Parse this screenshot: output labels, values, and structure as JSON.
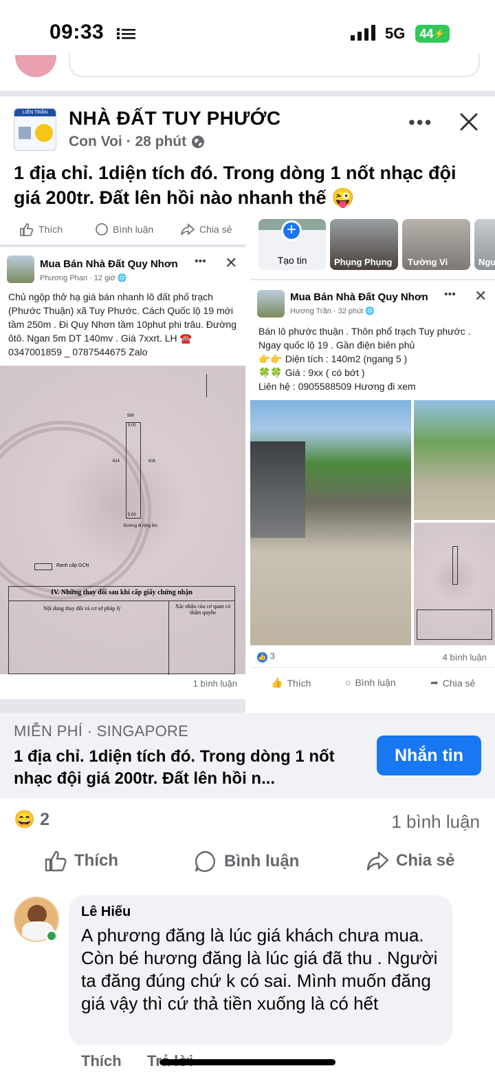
{
  "status_bar": {
    "time": "09:33",
    "network": "5G",
    "battery": "44"
  },
  "post": {
    "group_name": "NHÀ ĐẤT TUY PHƯỚC",
    "author": "Con Voi",
    "sep": "·",
    "time": "28 phút",
    "text": "1 địa chỉ. 1diện tích đó. Trong dòng 1 nốt nhạc đội giá 200tr. Đất lên hồi nào nhanh thế 😜",
    "group_logo_text": "LIÊN TRẦN"
  },
  "left_screenshot": {
    "actions": [
      "Thích",
      "Bình luận",
      "Chia sẻ"
    ],
    "group": "Mua Bán Nhà Đất Quy Nhơn",
    "author": "Phương Phan",
    "time": "12 giờ",
    "text": "Chủ ngộp thở hạ giá bán nhanh lô đất phố trạch (Phước Thuận) xã Tuy Phước. Cách Quốc lộ 19 mới tầm 250m . Đi Quy Nhơn tầm 10phut phi trâu. Đường ôtô. Ngan 5m DT 140mv . Giá 7xxrt. LH ☎️ 0347001859 _ 0787544675 Zalo",
    "cert_heading": "IV. Những thay đổi sau khi cấp giấy chứng nhận",
    "cert_col1": "Nội dung thay đổi và cơ sở pháp lý",
    "cert_col2": "Xác nhận của cơ quan có thẩm quyền",
    "cert_note": "Ranh cấp GCN",
    "plot_label": "Đường đi rộng 5m",
    "plot_top": "5.00",
    "plot_bottom": "5.00",
    "plot_left": "614",
    "plot_right": "616",
    "plot_num": "580",
    "comments": "1 bình luận"
  },
  "stories": {
    "create_label": "Tạo tin",
    "names": [
      "Phụng Phụng",
      "Tường Vi",
      "Ngu"
    ]
  },
  "right_screenshot": {
    "group": "Mua Bán Nhà Đất Quy Nhơn",
    "author": "Hương Trần",
    "time": "32 phút",
    "text1": "Bán lô phước thuận . Thôn phổ trạch Tuy phước . Ngay quốc lộ 19 . Gần điện biên phủ",
    "text2": "👉👉 Diện tích : 140m2 (ngang 5 )",
    "text3": "🍀🍀 Giá : 9xx ( có bớt )",
    "text4": "Liên hệ : 0905588509 Hương đi xem",
    "likes": "3",
    "comments": "4 bình luận",
    "actions": [
      "Thích",
      "Bình luận",
      "Chia sẻ"
    ]
  },
  "banner": {
    "line1": "MIỄN PHÍ · SINGAPORE",
    "title": "1 địa chỉ. 1diện tích đó. Trong dòng 1 nốt nhạc đội giá 200tr. Đất lên hồi n...",
    "button": "Nhắn tin"
  },
  "reactions": {
    "emoji": "😄",
    "count": "2",
    "comments": "1 bình luận"
  },
  "actions": {
    "like": "Thích",
    "comment": "Bình luận",
    "share": "Chia sẻ"
  },
  "comment": {
    "author": "Lê Hiếu",
    "text": "A phương đăng là lúc giá khách chưa mua. Còn bé hương đăng là lúc giá đã thu . Người ta đăng đúng chứ k có sai. Mình muốn đăng giá vậy thì cứ thả tiền xuống là có hết",
    "like": "Thích",
    "reply": "Trả lời"
  },
  "colors": {
    "accent": "#1877f2",
    "muted": "#65676b",
    "online": "#31a24c",
    "battery": "#34c759"
  }
}
